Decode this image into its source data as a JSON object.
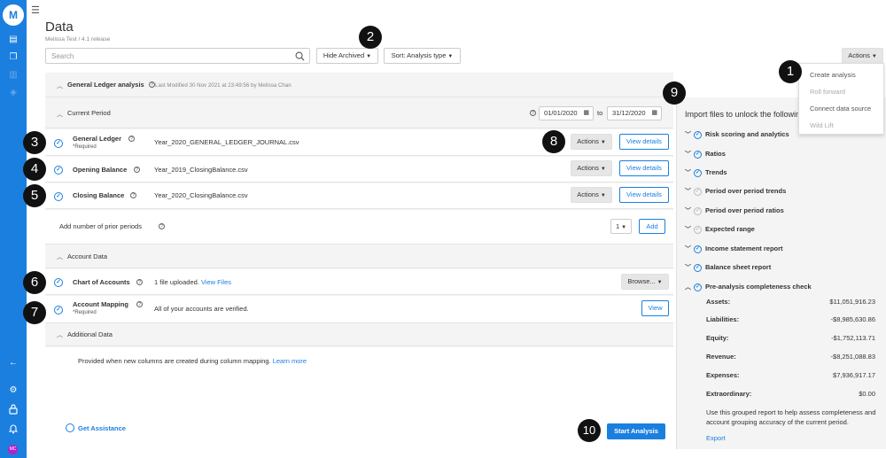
{
  "sidebar": {
    "logo": "M",
    "avatar_initials": "MC",
    "back_arrow": "←"
  },
  "header": {
    "title": "Data",
    "subtitle": "Melissa Test / 4.1 release"
  },
  "toolbar": {
    "search_placeholder": "Search",
    "hide_archived_label": "Hide Archived",
    "sort_label": "Sort: Analysis type",
    "actions_label": "Actions"
  },
  "actions_menu": {
    "items": [
      {
        "label": "Create analysis",
        "enabled": true
      },
      {
        "label": "Roll forward",
        "enabled": false
      },
      {
        "label": "Connect data source",
        "enabled": true
      },
      {
        "label": "Wild Lift",
        "enabled": false
      }
    ]
  },
  "analysis": {
    "title": "General Ledger analysis",
    "last_modified": "Last Modified 30 Nov 2021 at 23:49:56 by Melissa Chan"
  },
  "current_period": {
    "label": "Current Period",
    "date_from": "01/01/2020",
    "date_to_word": "to",
    "date_to": "31/12/2020",
    "rows": [
      {
        "label": "General Ledger",
        "required": "*Required",
        "file": "Year_2020_GENERAL_LEDGER_JOURNAL.csv",
        "actions": "Actions",
        "view": "View details"
      },
      {
        "label": "Opening Balance",
        "file": "Year_2019_ClosingBalance.csv",
        "actions": "Actions",
        "view": "View details"
      },
      {
        "label": "Closing Balance",
        "file": "Year_2020_ClosingBalance.csv",
        "actions": "Actions",
        "view": "View details"
      }
    ],
    "prior_periods_label": "Add number of prior periods",
    "prior_periods_value": "1",
    "add_label": "Add"
  },
  "account_data": {
    "label": "Account Data",
    "chart_of_accounts": {
      "label": "Chart of Accounts",
      "status": "1 file uploaded.",
      "link": "View Files",
      "browse": "Browse..."
    },
    "account_mapping": {
      "label": "Account Mapping",
      "required": "*Required",
      "status": "All of your accounts are verified.",
      "view": "View"
    }
  },
  "additional_data": {
    "label": "Additional Data",
    "text": "Provided when new columns are created during column mapping.",
    "link": "Learn more"
  },
  "footer": {
    "assistance": "Get Assistance",
    "start": "Start Analysis"
  },
  "unlock": {
    "title": "Import files to unlock the following",
    "items": [
      {
        "label": "Risk scoring and analytics",
        "done": true
      },
      {
        "label": "Ratios",
        "done": true
      },
      {
        "label": "Trends",
        "done": true
      },
      {
        "label": "Period over period trends",
        "done": false
      },
      {
        "label": "Period over period ratios",
        "done": false
      },
      {
        "label": "Expected range",
        "done": false
      },
      {
        "label": "Income statement report",
        "done": true
      },
      {
        "label": "Balance sheet report",
        "done": true
      },
      {
        "label": "Pre-analysis completeness check",
        "done": true
      }
    ],
    "balances": [
      {
        "label": "Assets:",
        "value": "$11,051,916.23"
      },
      {
        "label": "Liabilities:",
        "value": "-$8,985,630.86"
      },
      {
        "label": "Equity:",
        "value": "-$1,752,113.71"
      },
      {
        "label": "Revenue:",
        "value": "-$8,251,088.83"
      },
      {
        "label": "Expenses:",
        "value": "$7,936,917.17"
      },
      {
        "label": "Extraordinary:",
        "value": "$0.00"
      }
    ],
    "note": "Use this grouped report to help assess completeness and account grouping accuracy of the current period.",
    "export": "Export"
  },
  "callouts": [
    "1",
    "2",
    "3",
    "4",
    "5",
    "6",
    "7",
    "8",
    "9",
    "10"
  ]
}
